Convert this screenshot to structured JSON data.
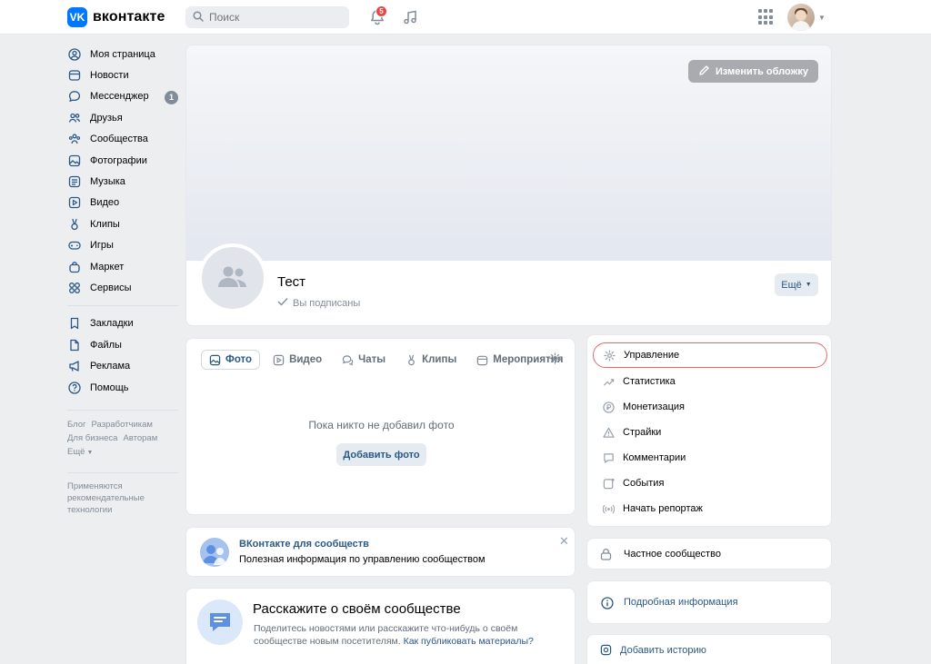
{
  "header": {
    "logo_text": "вконтакте",
    "logo_mark": "VK",
    "search_placeholder": "Поиск",
    "notifications_count": "5",
    "apps_icon": "grid-icon"
  },
  "sidebar": {
    "items": [
      {
        "label": "Моя страница",
        "icon": "user-circle-icon"
      },
      {
        "label": "Новости",
        "icon": "news-icon"
      },
      {
        "label": "Мессенджер",
        "icon": "message-icon",
        "count": "1"
      },
      {
        "label": "Друзья",
        "icon": "friends-icon"
      },
      {
        "label": "Сообщества",
        "icon": "communities-icon"
      },
      {
        "label": "Фотографии",
        "icon": "photo-icon"
      },
      {
        "label": "Музыка",
        "icon": "music-icon"
      },
      {
        "label": "Видео",
        "icon": "video-icon"
      },
      {
        "label": "Клипы",
        "icon": "clips-icon"
      },
      {
        "label": "Игры",
        "icon": "gamepad-icon"
      },
      {
        "label": "Маркет",
        "icon": "bag-icon"
      },
      {
        "label": "Сервисы",
        "icon": "services-icon"
      }
    ],
    "items2": [
      {
        "label": "Закладки",
        "icon": "bookmark-icon"
      },
      {
        "label": "Файлы",
        "icon": "file-icon"
      },
      {
        "label": "Реклама",
        "icon": "megaphone-icon"
      },
      {
        "label": "Помощь",
        "icon": "help-icon"
      }
    ],
    "footer_links": [
      "Блог",
      "Разработчикам",
      "Для бизнеса",
      "Авторам",
      "Ещё"
    ],
    "rec_note": "Применяются рекомендательные технологии"
  },
  "cover": {
    "change_cover": "Изменить обложку",
    "group_name": "Тест",
    "subscribed": "Вы подписаны",
    "more": "Ещё"
  },
  "media": {
    "tabs": [
      "Фото",
      "Видео",
      "Чаты",
      "Клипы",
      "Мероприятия"
    ],
    "empty_text": "Пока никто не добавил фото",
    "add_photo": "Добавить фото"
  },
  "management": {
    "items": [
      {
        "label": "Управление",
        "icon": "gear-icon"
      },
      {
        "label": "Статистика",
        "icon": "chart-icon"
      },
      {
        "label": "Монетизация",
        "icon": "ruble-icon"
      },
      {
        "label": "Страйки",
        "icon": "warning-icon"
      },
      {
        "label": "Комментарии",
        "icon": "comment-icon"
      },
      {
        "label": "События",
        "icon": "event-icon"
      },
      {
        "label": "Начать репортаж",
        "icon": "broadcast-icon"
      }
    ]
  },
  "promo": {
    "title": "ВКонтакте для сообществ",
    "text": "Полезная информация по управлению сообществом"
  },
  "private": {
    "label": "Частное сообщество"
  },
  "info": {
    "label": "Подробная информация"
  },
  "story": {
    "label": "Добавить историю"
  },
  "about": {
    "title": "Расскажите о своём сообществе",
    "text": "Поделитесь новостями или расскажите что-нибудь о своём сообществе новым посетителям.",
    "link": "Как публиковать материалы?"
  }
}
